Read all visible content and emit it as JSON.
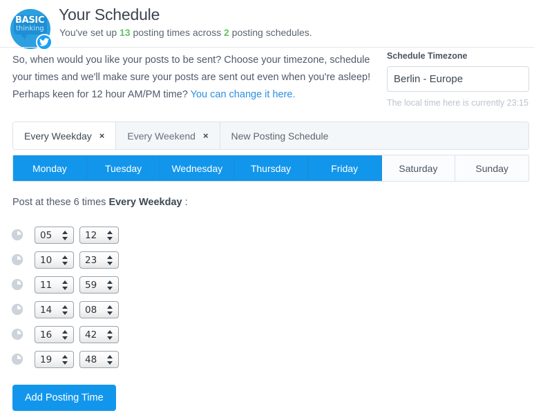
{
  "header": {
    "title": "Your Schedule",
    "subtitle_prefix": "You've set up ",
    "posting_times_count": "13",
    "subtitle_middle": " posting times across ",
    "schedules_count": "2",
    "subtitle_suffix": " posting schedules.",
    "avatar": {
      "brand_line1": "BASIC",
      "brand_line2": "thinking",
      "badge_icon": "twitter-bird-icon"
    }
  },
  "intro": {
    "line1": "So, when would you like your posts to be sent? Choose your timezone, schedule your times and we'll make sure your posts are sent out even when you're asleep!",
    "line2_prefix": "Perhaps keen for 12 hour AM/PM time? ",
    "link_text": "You can change it here."
  },
  "timezone": {
    "label": "Schedule Timezone",
    "value": "Berlin - Europe",
    "options": [
      "Berlin - Europe"
    ],
    "hint": "The local time here is currently 23:15"
  },
  "schedule_tabs": [
    {
      "label": "Every Weekday",
      "active": true,
      "closable": true,
      "close_glyph": "×"
    },
    {
      "label": "Every Weekend",
      "active": false,
      "closable": true,
      "close_glyph": "×"
    },
    {
      "label": "New Posting Schedule",
      "active": false,
      "closable": false
    }
  ],
  "days": [
    {
      "label": "Monday",
      "selected": true
    },
    {
      "label": "Tuesday",
      "selected": true
    },
    {
      "label": "Wednesday",
      "selected": true
    },
    {
      "label": "Thursday",
      "selected": true
    },
    {
      "label": "Friday",
      "selected": true
    },
    {
      "label": "Saturday",
      "selected": false
    },
    {
      "label": "Sunday",
      "selected": false
    }
  ],
  "post_line": {
    "prefix": "Post at these 6 times ",
    "schedule_name": "Every Weekday",
    "suffix": " :"
  },
  "times": [
    {
      "hour": "05",
      "minute": "12"
    },
    {
      "hour": "10",
      "minute": "23"
    },
    {
      "hour": "11",
      "minute": "59"
    },
    {
      "hour": "14",
      "minute": "08"
    },
    {
      "hour": "16",
      "minute": "42"
    },
    {
      "hour": "19",
      "minute": "48"
    }
  ],
  "add_button": {
    "label": "Add Posting Time"
  },
  "colors": {
    "accent_blue": "#1296ec",
    "link_blue": "#2a8fe0",
    "stat_green": "#62c462",
    "text_dark": "#3d4852",
    "muted": "#bcc3cb"
  }
}
